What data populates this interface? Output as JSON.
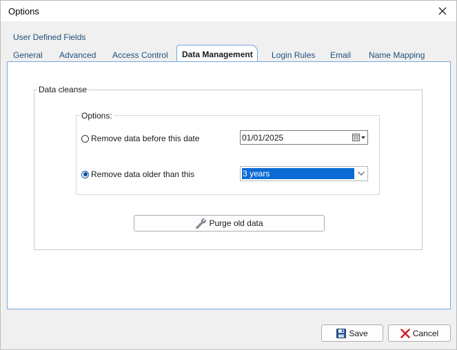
{
  "window": {
    "title": "Options"
  },
  "tabs": {
    "row1": [
      {
        "label": "User Defined Fields"
      }
    ],
    "row2": [
      {
        "label": "General"
      },
      {
        "label": "Advanced"
      },
      {
        "label": "Access Control"
      },
      {
        "label": "Data Management",
        "active": true
      },
      {
        "label": "Login Rules"
      },
      {
        "label": "Email"
      },
      {
        "label": "Name Mapping"
      }
    ]
  },
  "data_cleanse": {
    "legend": "Data cleanse",
    "options_legend": "Options:",
    "radio_before_date": {
      "label": "Remove data before this date",
      "checked": false
    },
    "radio_older_than": {
      "label": "Remove data older than this",
      "checked": true
    },
    "date_value": "01/01/2025",
    "age_value": "3 years",
    "purge_label": "Purge old data"
  },
  "footer": {
    "save_label": "Save",
    "cancel_label": "Cancel"
  },
  "colors": {
    "accent": "#0b6bd3",
    "tab_text": "#1f4e7a",
    "panel_border": "#7aa6d8",
    "cancel_red": "#d0202a"
  },
  "icons": {
    "close": "close-icon",
    "calendar": "calendar-icon",
    "dropdown": "chevron-down-icon",
    "purge": "wrench-icon",
    "save": "floppy-disk-icon",
    "cancel": "red-x-icon"
  }
}
